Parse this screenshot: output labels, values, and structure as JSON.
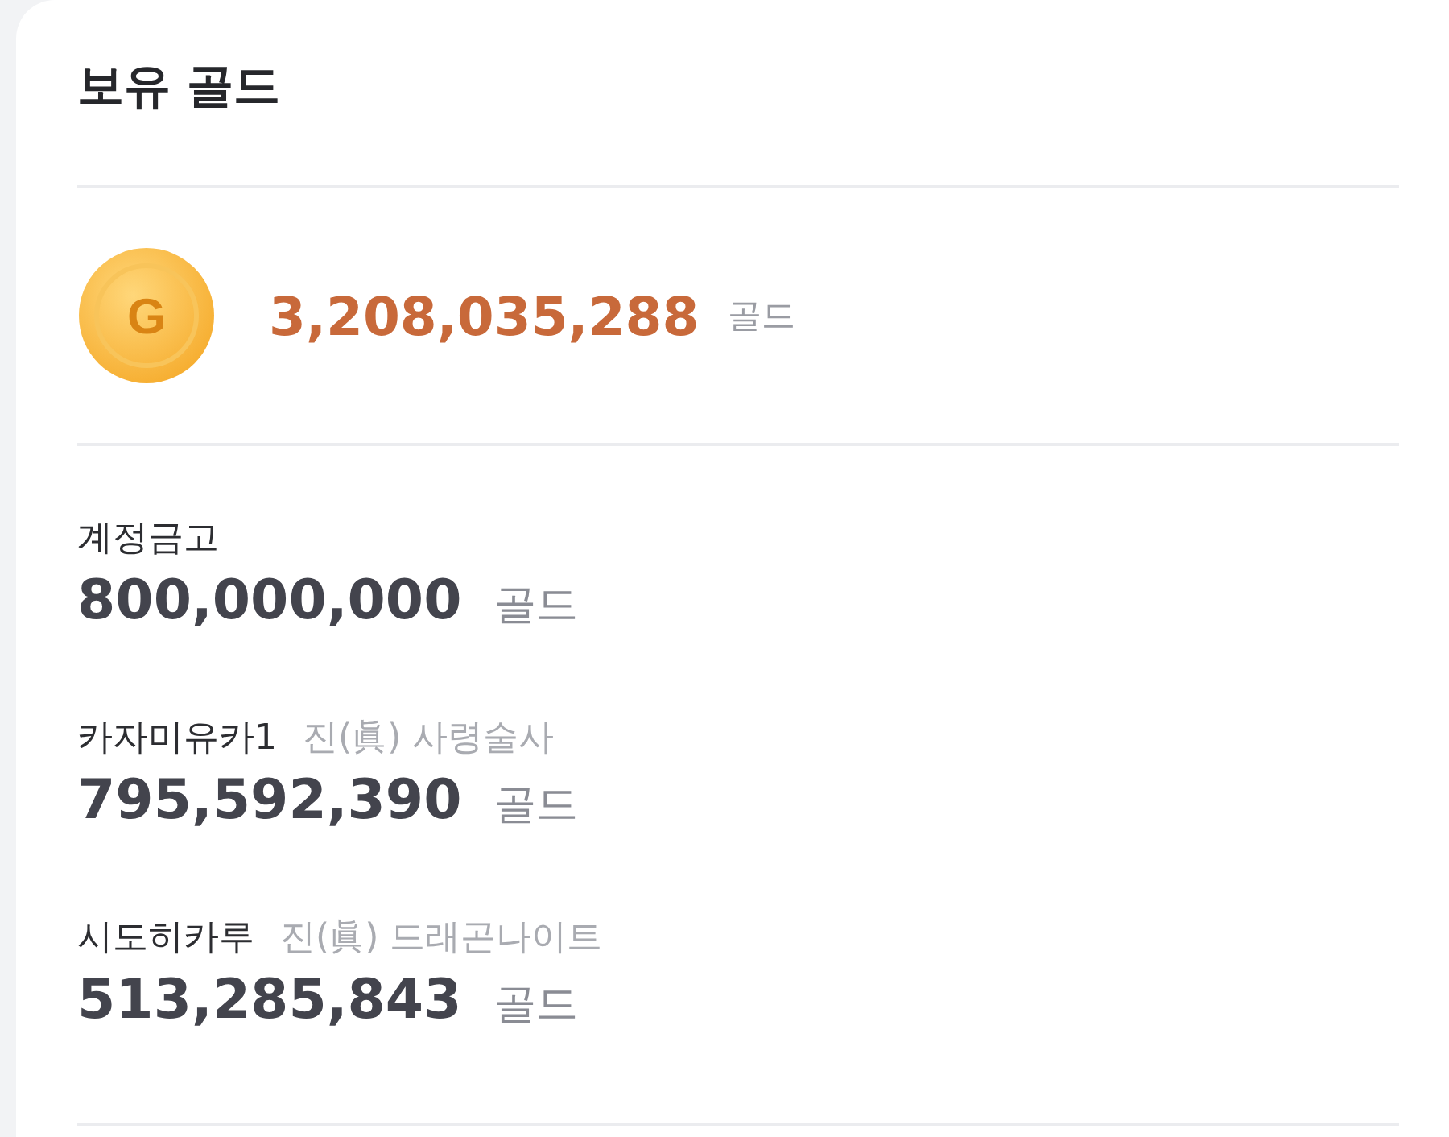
{
  "title": "보유 골드",
  "total": {
    "coin_label": "G",
    "amount": "3,208,035,288",
    "unit": "골드"
  },
  "entries": [
    {
      "name": "계정금고",
      "amount": "800,000,000",
      "unit": "골드"
    },
    {
      "name": "카자미유카1",
      "job": "진(眞) 사령술사",
      "amount": "795,592,390",
      "unit": "골드"
    },
    {
      "name": "시도히카루",
      "job": "진(眞) 드래곤나이트",
      "amount": "513,285,843",
      "unit": "골드"
    }
  ]
}
